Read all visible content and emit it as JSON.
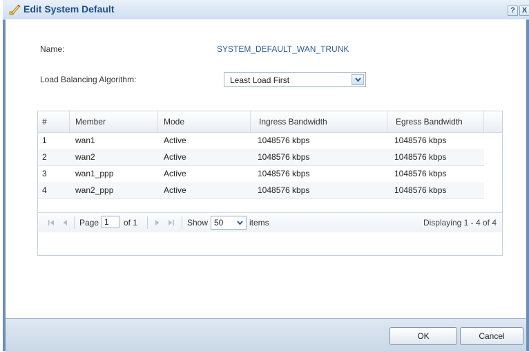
{
  "dialog": {
    "title": "Edit System Default",
    "help_label": "?",
    "close_label": "X"
  },
  "form": {
    "name_label": "Name:",
    "name_value": "SYSTEM_DEFAULT_WAN_TRUNK",
    "algorithm_label": "Load Balancing Algorithm:",
    "algorithm_value": "Least Load First"
  },
  "table": {
    "columns": [
      "#",
      "Member",
      "Mode",
      "Ingress Bandwidth",
      "Egress Bandwidth"
    ],
    "rows": [
      {
        "num": "1",
        "member": "wan1",
        "mode": "Active",
        "ingress": "1048576 kbps",
        "egress": "1048576 kbps"
      },
      {
        "num": "2",
        "member": "wan2",
        "mode": "Active",
        "ingress": "1048576 kbps",
        "egress": "1048576 kbps"
      },
      {
        "num": "3",
        "member": "wan1_ppp",
        "mode": "Active",
        "ingress": "1048576 kbps",
        "egress": "1048576 kbps"
      },
      {
        "num": "4",
        "member": "wan2_ppp",
        "mode": "Active",
        "ingress": "1048576 kbps",
        "egress": "1048576 kbps"
      }
    ]
  },
  "pager": {
    "page_label": "Page",
    "page_value": "1",
    "of_label": "of 1",
    "show_label": "Show",
    "show_value": "50",
    "items_label": "items",
    "displaying": "Displaying 1 - 4 of 4"
  },
  "footer": {
    "ok_label": "OK",
    "cancel_label": "Cancel"
  },
  "colors": {
    "title_text": "#1f4d84",
    "link_value": "#2e5e9a",
    "frame": "#6d8fb3"
  }
}
